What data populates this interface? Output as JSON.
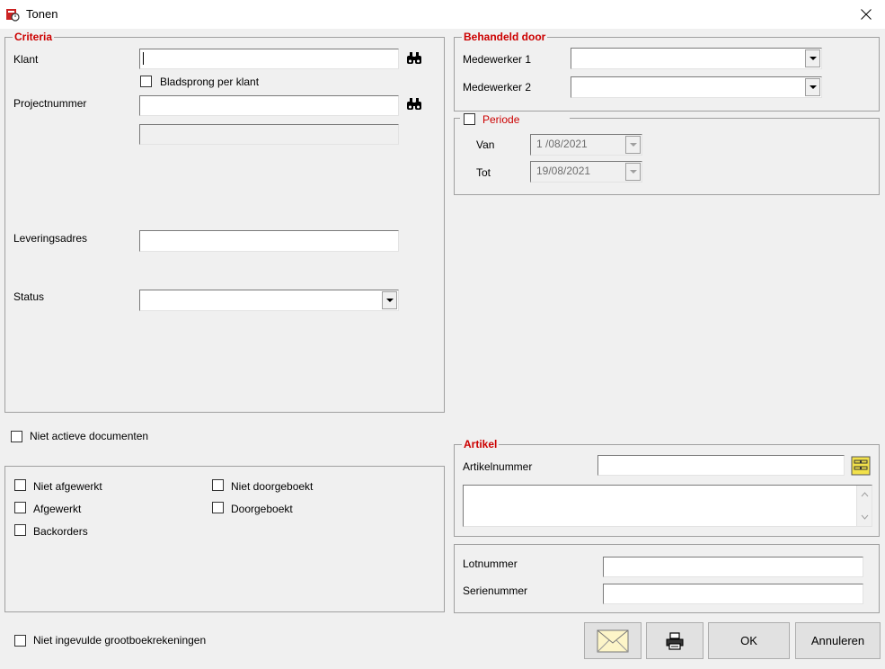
{
  "window": {
    "title": "Tonen"
  },
  "criteria": {
    "legend": "Criteria",
    "klant_label": "Klant",
    "klant_value": "",
    "bladsprong_label": "Bladsprong per klant",
    "projectnummer_label": "Projectnummer",
    "projectnummer_value": "",
    "leveringsadres_label": "Leveringsadres",
    "status_label": "Status",
    "status_value": ""
  },
  "behandeld": {
    "legend": "Behandeld door",
    "medewerker1_label": "Medewerker 1",
    "medewerker2_label": "Medewerker 2"
  },
  "periode": {
    "label": "Periode",
    "van_label": "Van",
    "van_value": "1 /08/2021",
    "tot_label": "Tot",
    "tot_value": "19/08/2021"
  },
  "options": {
    "niet_actieve": "Niet actieve documenten",
    "niet_afgewerkt": "Niet afgewerkt",
    "afgewerkt": "Afgewerkt",
    "backorders": "Backorders",
    "niet_doorgeboekt": "Niet doorgeboekt",
    "doorgeboekt": "Doorgeboekt",
    "niet_ingevulde": "Niet ingevulde grootboekrekeningen"
  },
  "artikel": {
    "legend": "Artikel",
    "artikelnummer_label": "Artikelnummer"
  },
  "lot": {
    "lotnummer_label": "Lotnummer",
    "serienummer_label": "Serienummer"
  },
  "buttons": {
    "ok": "OK",
    "annuleren": "Annuleren"
  },
  "colors": {
    "legend": "#cc0000",
    "background": "#f0f0f0"
  }
}
